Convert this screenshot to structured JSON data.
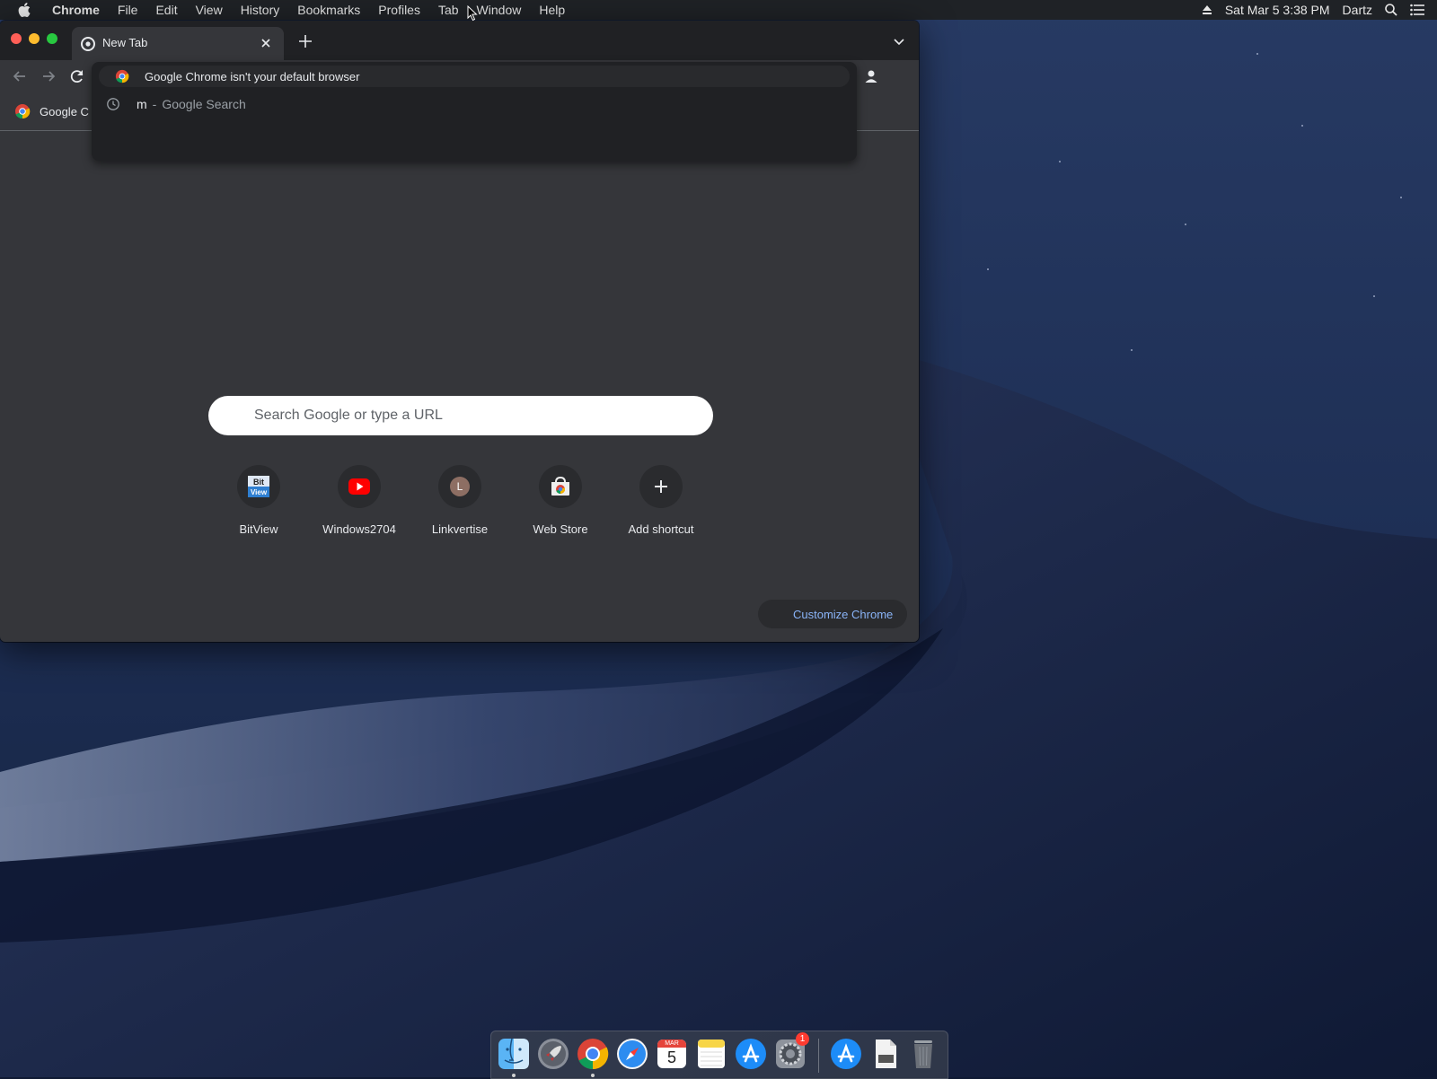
{
  "menubar": {
    "app_name": "Chrome",
    "items": [
      "File",
      "Edit",
      "View",
      "History",
      "Bookmarks",
      "Profiles",
      "Tab",
      "Window",
      "Help"
    ],
    "clock": "Sat Mar 5  3:38 PM",
    "user": "Dartz",
    "icons": [
      "apple-icon",
      "eject-icon",
      "spotlight-search-icon",
      "notification-center-icon"
    ]
  },
  "browser": {
    "tab": {
      "title": "New Tab",
      "favicon": "chrome-newtab-icon"
    },
    "omnibox": {
      "text": "Google Chrome isn't your default browser",
      "suggestion": {
        "query": "m",
        "separator": "-",
        "suffix": "Google Search"
      }
    },
    "bookmarks_bar": {
      "item": "Google C"
    },
    "new_tab_page": {
      "search_placeholder": "Search Google or type a URL",
      "shortcuts": [
        {
          "label": "BitView",
          "icon": "bitview-icon"
        },
        {
          "label": "Windows2704",
          "icon": "youtube-icon"
        },
        {
          "label": "Linkvertise",
          "icon": "letter-l-icon",
          "letter": "L"
        },
        {
          "label": "Web Store",
          "icon": "web-store-icon"
        },
        {
          "label": "Add shortcut",
          "icon": "plus-icon"
        }
      ],
      "customize_label": "Customize Chrome"
    }
  },
  "dock": {
    "apps": [
      "Finder",
      "Launchpad",
      "Google Chrome",
      "Safari",
      "Calendar",
      "Notes",
      "App Store",
      "System Preferences",
      "App Store",
      "Documents",
      "Trash"
    ],
    "calendar": {
      "month": "MAR",
      "day": "5"
    },
    "system_prefs_badge": "1"
  },
  "colors": {
    "window_bg": "#35363a",
    "tab_strip": "#202124",
    "link_blue": "#8ab4f8",
    "text": "#e8eaed"
  }
}
